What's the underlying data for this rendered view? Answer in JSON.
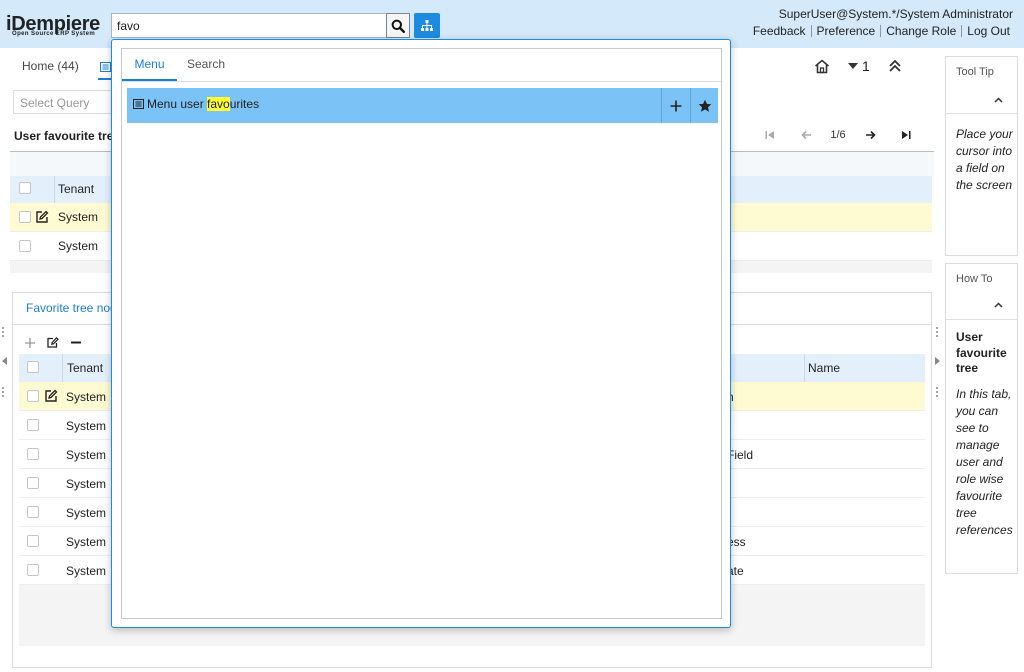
{
  "header": {
    "logo_main": "iDempiere",
    "logo_sub": "Open Source  ERP System",
    "search_value": "favo",
    "user": "SuperUser@System.*/System Administrator",
    "links": [
      "Feedback",
      "Preference",
      "Change Role",
      "Log Out"
    ]
  },
  "window": {
    "tabs": [
      "Home (44)"
    ],
    "record_count": "1",
    "select_query_placeholder": "Select Query",
    "grid_title": "User favourite tree",
    "pager": "1/6",
    "grid": {
      "columns": [
        "Tenant"
      ],
      "rows": [
        [
          "System"
        ],
        [
          "System"
        ]
      ]
    }
  },
  "detail": {
    "tab_label": "Favorite tree node",
    "columns": [
      "Tenant",
      "Name"
    ],
    "rows": [
      {
        "tenant": "System",
        "tail": "n"
      },
      {
        "tenant": "System",
        "tail": ""
      },
      {
        "tenant": "System",
        "tail": "Field"
      },
      {
        "tenant": "System",
        "tail": ""
      },
      {
        "tenant": "System",
        "tail": ""
      },
      {
        "tenant": "System",
        "tail": "ess"
      },
      {
        "tenant": "System",
        "tail": "ate"
      }
    ]
  },
  "side": {
    "tooltip_title": "Tool Tip",
    "tooltip_text": "Place your cursor into a field on the screen",
    "howto_title": "How To",
    "howto_heading": "User favourite tree",
    "howto_text": "In this tab, you can see to manage user and role wise favourite tree references"
  },
  "popup": {
    "tabs": [
      "Menu",
      "Search"
    ],
    "result": {
      "prefix": "Menu user ",
      "highlight": "favo",
      "suffix": "urites"
    }
  },
  "colors": {
    "accent": "#1c8be0",
    "header_bg": "#d4e9f9",
    "selected_row": "#fefbd3",
    "result_row": "#7bc3f7",
    "highlight": "#ffff33"
  }
}
